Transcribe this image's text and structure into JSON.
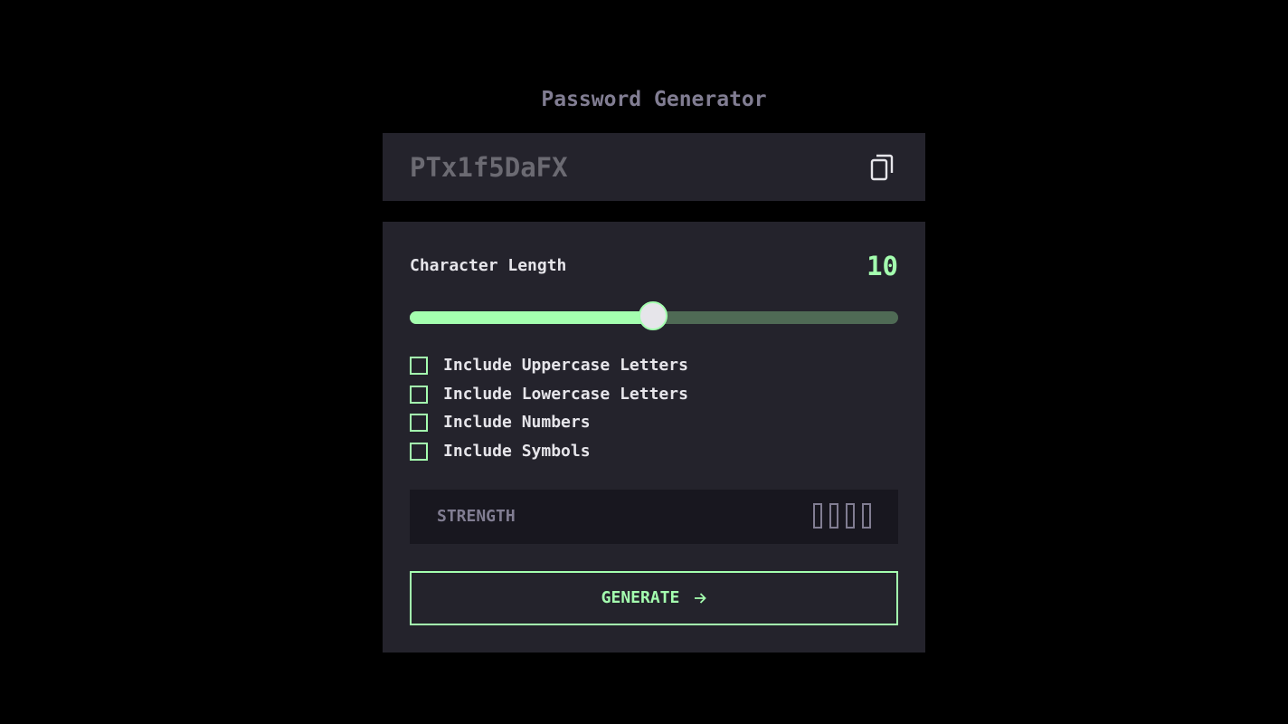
{
  "app": {
    "title": "Password Generator"
  },
  "output": {
    "password": "PTx1f5DaFX",
    "copy_icon": "copy-icon"
  },
  "length": {
    "label": "Character Length",
    "value": "10",
    "slider_fraction": 0.5
  },
  "options": [
    {
      "label": "Include Uppercase Letters",
      "checked": false
    },
    {
      "label": "Include Lowercase Letters",
      "checked": false
    },
    {
      "label": "Include Numbers",
      "checked": false
    },
    {
      "label": "Include Symbols",
      "checked": false
    }
  ],
  "strength": {
    "label": "STRENGTH",
    "filled_bars": 0,
    "total_bars": 4
  },
  "generate": {
    "label": "GENERATE",
    "icon": "arrow-right-icon"
  },
  "colors": {
    "accent": "#a4ffaf",
    "panel": "#24232c",
    "strength_bg": "#18171f",
    "muted": "#817d92",
    "text": "#e6e5ea"
  }
}
